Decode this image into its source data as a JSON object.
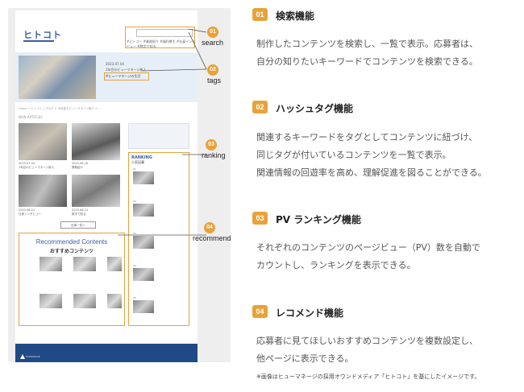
{
  "mockup": {
    "logo": "ヒトコト",
    "search_tags": "#ヒトコト #業務紹介 #福利厚生 #社員インタビュー #数字で知る",
    "hero": {
      "date": "2023.07.04",
      "title": "2年目のビューマネージ新人",
      "tag": "#ヒューマネージの生活"
    },
    "breadcrumb": "Home > ヒトコト | ブログ > 今年度もビューマネージ新人 > ...",
    "new_articles_label": "NEW ARTICLES",
    "cards": [
      {
        "date": "2023.07.04",
        "title": "2年目のビューマネージ新人"
      },
      {
        "date": "2023.06.28",
        "title": "業務紹介"
      },
      {
        "date": "2023.06.21",
        "title": "社員インタビュー"
      },
      {
        "date": "2023.06.14",
        "title": "数字で知る"
      }
    ],
    "more_button": "記事一覧へ",
    "ranking_title": "RANKING",
    "ranking_subtitle": "人気記事",
    "ranking_items": [
      "01",
      "02",
      "03",
      "04",
      "05"
    ],
    "recommend_title": "Recommended Contents",
    "recommend_subtitle": "おすすめコンテンツ",
    "footer": "HUMANAGE"
  },
  "callouts": [
    {
      "num": "01",
      "label": "search"
    },
    {
      "num": "02",
      "label": "tags"
    },
    {
      "num": "03",
      "label": "ranking"
    },
    {
      "num": "04",
      "label": "recommend"
    }
  ],
  "features": [
    {
      "num": "01",
      "title": "検索機能",
      "lines": [
        "制作したコンテンツを検索し、一覧で表示。応募者は、",
        "自分の知りたいキーワードでコンテンツを検索できる。"
      ]
    },
    {
      "num": "02",
      "title": "ハッシュタグ機能",
      "lines": [
        "関連するキーワードをタグとしてコンテンツに紐づけ、",
        "同じタグが付いているコンテンツを一覧で表示。",
        "関連情報の回遊率を高め、理解促進を図ることができる。"
      ]
    },
    {
      "num": "03",
      "title": "PV ランキング機能",
      "lines": [
        "それぞれのコンテンツのページビュー（PV）数を自動で",
        "カウントし、ランキングを表示できる。"
      ]
    },
    {
      "num": "04",
      "title": "レコメンド機能",
      "lines": [
        "応募者に見てほしいおすすめコンテンツを複数設定し、",
        "他ページに表示できる。"
      ]
    }
  ],
  "note": "※画像はヒューマネージの採用オウンドメディア「ヒトコト」を基にしたイメージです。"
}
